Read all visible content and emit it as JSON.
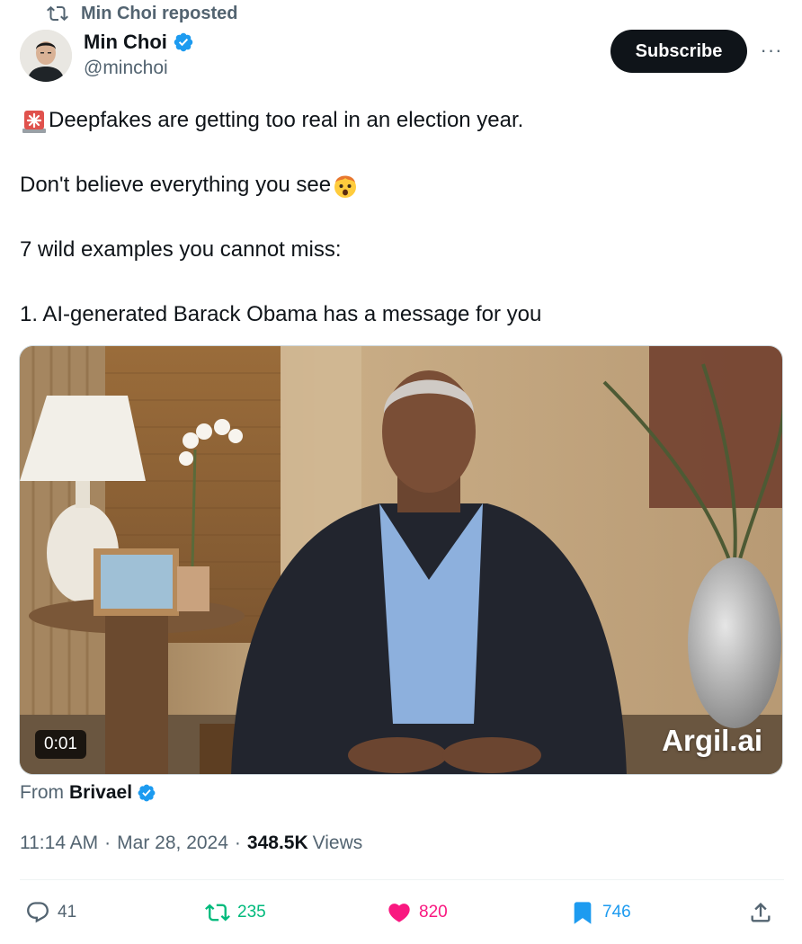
{
  "repost_banner": {
    "text": "Min Choi reposted",
    "icon": "repost-icon"
  },
  "author": {
    "display_name": "Min Choi",
    "handle": "@minchoi",
    "verified": true,
    "avatar_icon": "avatar"
  },
  "header_actions": {
    "subscribe_label": "Subscribe",
    "more_label": "···"
  },
  "tweet": {
    "lines": [
      "Deepfakes are getting too real in an election year.",
      "Don't believe everything you see",
      "7 wild examples you cannot miss:",
      "1. AI-generated Barack Obama has a message for you"
    ],
    "emojis": [
      "rotating-light-emoji",
      "exploding-head-emoji"
    ]
  },
  "media": {
    "duration": "0:01",
    "watermark": "Argil.ai"
  },
  "attribution": {
    "prefix": "From",
    "source_name": "Brivael",
    "verified": true
  },
  "meta": {
    "time": "11:14 AM",
    "separator": "·",
    "date": "Mar 28, 2024",
    "views_count": "348.5K",
    "views_label": "Views"
  },
  "actions": {
    "replies": "41",
    "reposts": "235",
    "likes": "820",
    "bookmarks": "746"
  },
  "colors": {
    "text_primary": "#0f1419",
    "text_secondary": "#536471",
    "verified_blue": "#1d9bf0",
    "repost_green": "#00ba7c",
    "like_pink": "#f91880",
    "button_dark": "#0f1419"
  }
}
